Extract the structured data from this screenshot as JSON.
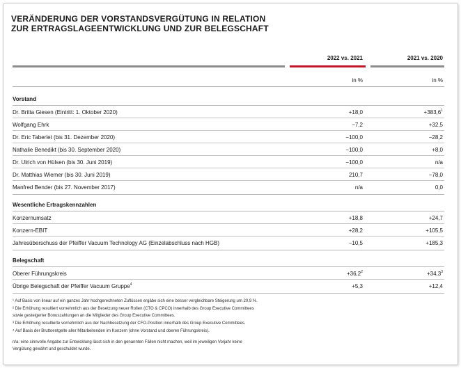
{
  "title": {
    "line1": "VERÄNDERUNG DER VORSTANDSVERGÜTUNG IN RELATION",
    "line2": "ZUR ERTRAGSLAGEENTWICKLUNG UND ZUR BELEGSCHAFT"
  },
  "columns": {
    "col1": "2022 vs. 2021",
    "col2": "2021 vs. 2020",
    "unit1": "in %",
    "unit2": "in %"
  },
  "sections": {
    "vorstand": "Vorstand",
    "ertrag": "Wesentliche Ertragskennzahlen",
    "belegschaft": "Belegschaft"
  },
  "rows": {
    "r1": {
      "label": "Dr. Britta Giesen (Eintritt: 1. Oktober 2020)",
      "v1": "+18,0",
      "v2": "+383,6",
      "v2_sup": "1"
    },
    "r2": {
      "label": "Wolfgang Ehrk",
      "v1": "−7,2",
      "v2": "+32,5"
    },
    "r3": {
      "label": "Dr. Eric Taberlet (bis 31. Dezember 2020)",
      "v1": "−100,0",
      "v2": "−28,2"
    },
    "r4": {
      "label": "Nathalie Benedikt (bis 30. September 2020)",
      "v1": "−100,0",
      "v2": "+8,0"
    },
    "r5": {
      "label": "Dr. Ulrich von Hülsen (bis 30. Juni 2019)",
      "v1": "−100,0",
      "v2": "n/a"
    },
    "r6": {
      "label": "Dr. Matthias Wiemer (bis 30. Juni 2019)",
      "v1": "210,7",
      "v2": "−78,0"
    },
    "r7": {
      "label": "Manfred Bender (bis 27. November 2017)",
      "v1": "n/a",
      "v2": "0,0"
    },
    "r8": {
      "label": "Konzernumsatz",
      "v1": "+18,8",
      "v2": "+24,7"
    },
    "r9": {
      "label": "Konzern-EBIT",
      "v1": "+28,2",
      "v2": "+105,5"
    },
    "r10": {
      "label": "Jahresüberschuss der Pfeiffer Vacuum Technology AG (Einzelabschluss nach HGB)",
      "v1": "−10,5",
      "v2": "+185,3"
    },
    "r11": {
      "label": "Oberer Führungskreis",
      "v1": "+36,2",
      "v1_sup": "2",
      "v2": "+34,3",
      "v2_sup": "3"
    },
    "r12": {
      "label": "Übrige Belegschaft der Pfeiffer Vacuum Gruppe",
      "label_sup": "4",
      "v1": "+5,3",
      "v2": "+12,4"
    }
  },
  "footnotes": {
    "f1": "¹ Auf Basis von linear auf ein ganzes Jahr hochgerechneten Zuflüssen ergäbe sich eine besser vergleichbare Steigerung um 20,9 %.",
    "f2a": "² Die Erhöhung resultiert vornehmlich aus der Besetzung neuer Rollen (CTO & CPCO) innerhalb des Group Executive Committees",
    "f2b": "sowie gesteigerter Bonuszahlungen an die Mitglieder des Group Executive Committees.",
    "f3": "³ Die Erhöhung resultierte vornehmlich aus der Nachbesetzung der CFO-Position innerhalb des Group Executive Committees.",
    "f4": "⁴ Auf Basis der Bruttoentgelte aller Mitarbeitenden im Konzern (ohne Vorstand und oberen Führungskreis).",
    "na1": "n/a: eine sinnvolle Angabe zur Entwicklung lässt sich in den genannten Fällen nicht machen, weil im jeweiligen Vorjahr keine",
    "na2": "Vergütung gewährt und geschuldet wurde."
  }
}
